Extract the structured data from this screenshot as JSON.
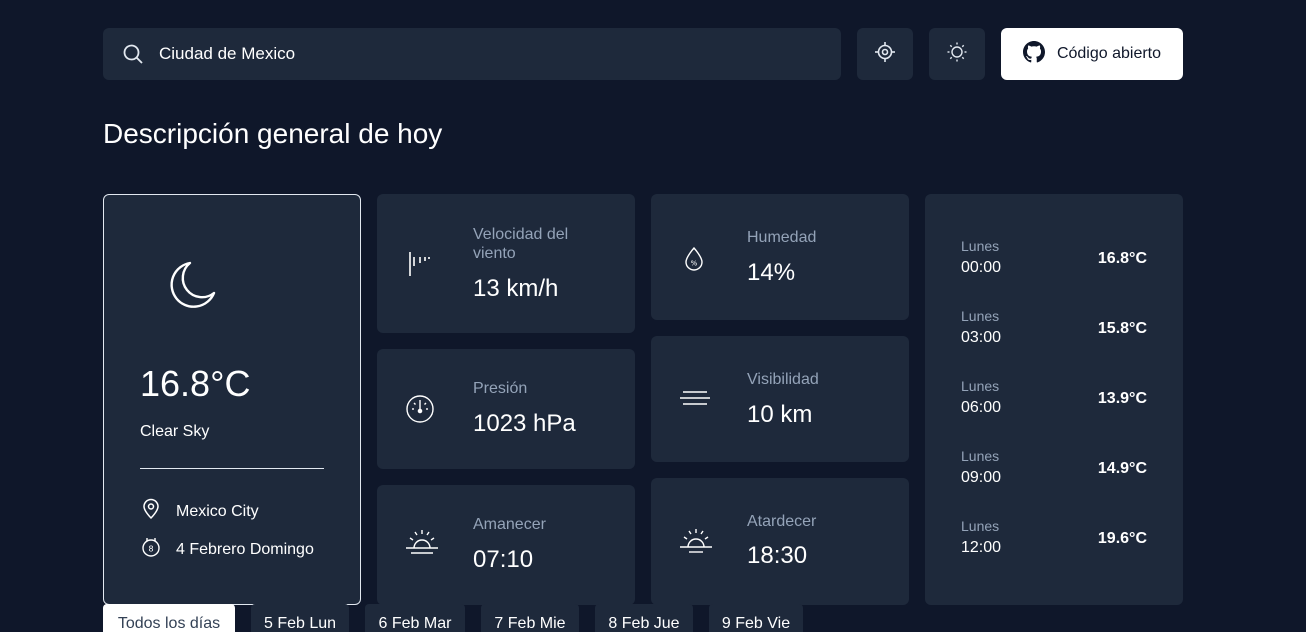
{
  "search": {
    "value": "Ciudad de Mexico",
    "placeholder": ""
  },
  "header": {
    "github_label": "Código abierto"
  },
  "page_title": "Descripción general de hoy",
  "current": {
    "temperature": "16.8°C",
    "description": "Clear Sky",
    "location": "Mexico City",
    "date": "4 Febrero Domingo"
  },
  "stats": {
    "wind": {
      "label": "Velocidad del viento",
      "value": "13 km/h"
    },
    "humidity": {
      "label": "Humedad",
      "value": "14%"
    },
    "pressure": {
      "label": "Presión",
      "value": "1023 hPa"
    },
    "visibility": {
      "label": "Visibilidad",
      "value": "10 km"
    },
    "sunrise": {
      "label": "Amanecer",
      "value": "07:10"
    },
    "sunset": {
      "label": "Atardecer",
      "value": "18:30"
    }
  },
  "hourly": [
    {
      "day": "Lunes",
      "time": "00:00",
      "temp": "16.8°C"
    },
    {
      "day": "Lunes",
      "time": "03:00",
      "temp": "15.8°C"
    },
    {
      "day": "Lunes",
      "time": "06:00",
      "temp": "13.9°C"
    },
    {
      "day": "Lunes",
      "time": "09:00",
      "temp": "14.9°C"
    },
    {
      "day": "Lunes",
      "time": "12:00",
      "temp": "19.6°C"
    }
  ],
  "tabs": [
    "Todos los días",
    "5 Feb Lun",
    "6 Feb Mar",
    "7 Feb Mie",
    "8 Feb Jue",
    "9 Feb Vie"
  ],
  "icons": {
    "search": "search-icon",
    "location": "crosshair-icon",
    "theme": "sun-icon",
    "github": "github-icon",
    "weather": "moon-icon",
    "pin": "map-pin-icon",
    "calendar": "calendar-icon"
  },
  "colors": {
    "background": "#0f172a",
    "card": "#1e293b",
    "muted": "#94a3b8",
    "accent": "#ffffff"
  }
}
